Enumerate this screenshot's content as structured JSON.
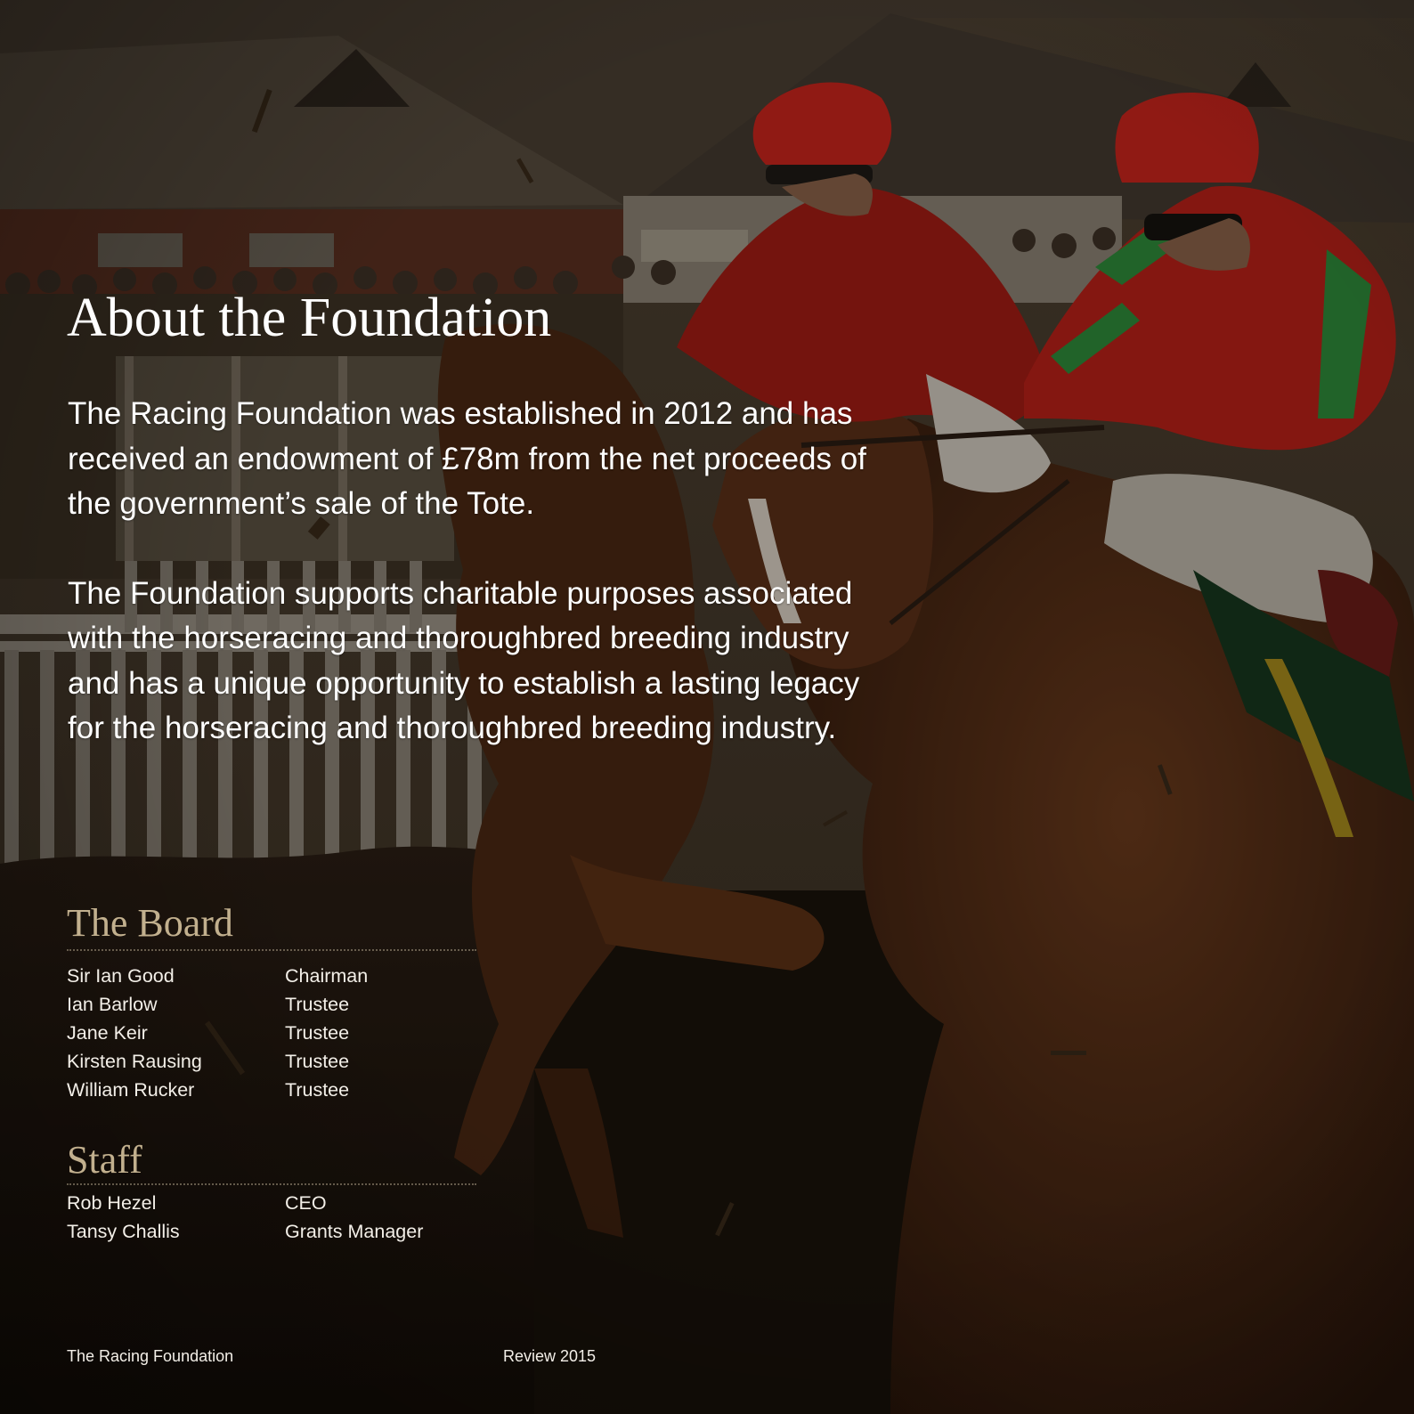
{
  "heading": "About the Foundation",
  "intro_paragraphs": [
    "The Racing Foundation was established in 2012 and has received an endowment of £78m from the net proceeds of the government’s sale of the Tote.",
    "The Foundation supports charitable purposes associated with the horseracing and thoroughbred breeding industry and has a unique opportunity to establish a lasting legacy for the horseracing and thoroughbred breeding industry."
  ],
  "board": {
    "title": "The Board",
    "members": [
      {
        "name": "Sir Ian Good",
        "role": "Chairman"
      },
      {
        "name": "Ian Barlow",
        "role": "Trustee"
      },
      {
        "name": "Jane Keir",
        "role": "Trustee"
      },
      {
        "name": "Kirsten Rausing",
        "role": "Trustee"
      },
      {
        "name": "William Rucker",
        "role": "Trustee"
      }
    ]
  },
  "staff": {
    "title": "Staff",
    "members": [
      {
        "name": "Rob Hezel",
        "role": "CEO"
      },
      {
        "name": "Tansy Challis",
        "role": "Grants Manager"
      }
    ]
  },
  "footer": {
    "left": "The Racing Foundation",
    "right": "Review 2015"
  },
  "colors": {
    "heading_text": "#ffffff",
    "section_title": "#c2b08e",
    "jockey_red": "#c8241c",
    "jockey_green": "#2e8a3a"
  },
  "background_image": "horse-racing-photo"
}
